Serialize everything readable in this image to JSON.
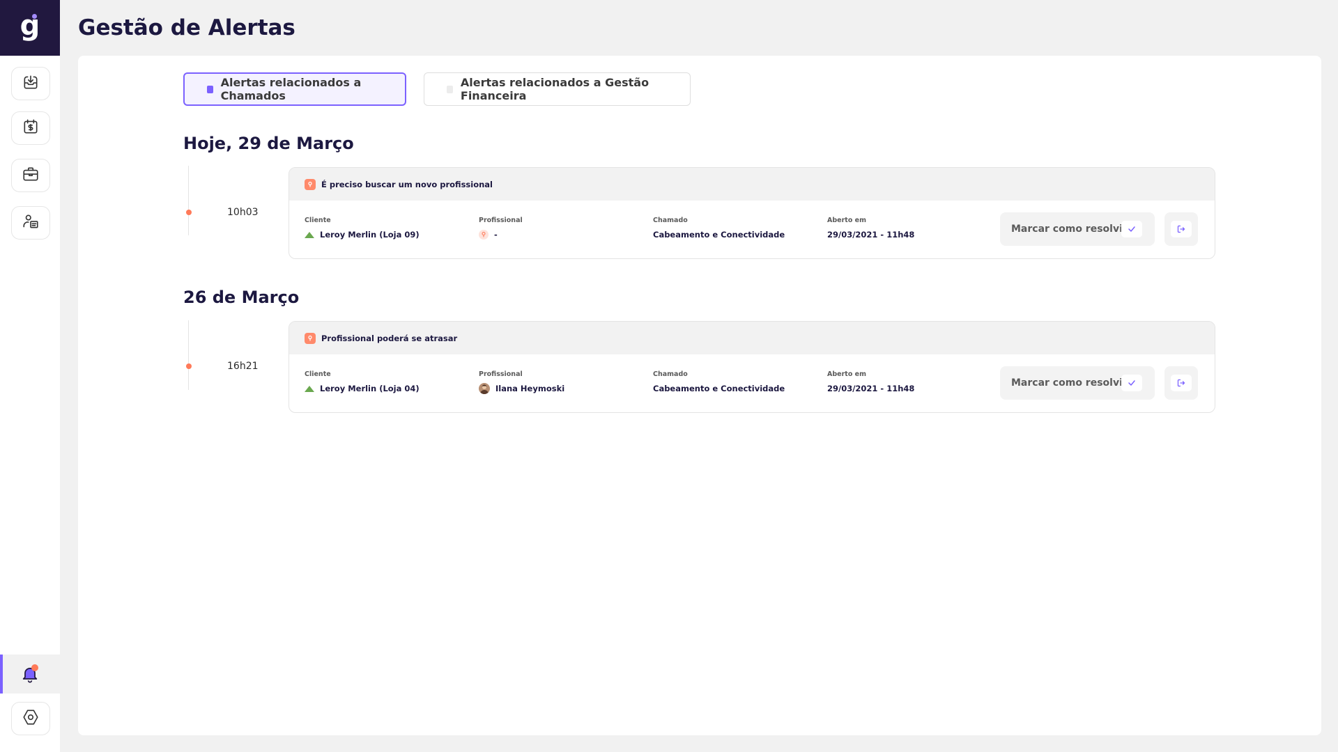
{
  "page": {
    "title": "Gestão de Alertas"
  },
  "sidebar": {
    "logo_letter": "g",
    "items": [
      {
        "icon": "download-tray-icon"
      },
      {
        "icon": "finance-calendar-icon"
      },
      {
        "icon": "briefcase-icon"
      },
      {
        "icon": "user-document-icon"
      }
    ],
    "bottom": [
      {
        "icon": "bell-icon",
        "active": true,
        "has_notification": true
      },
      {
        "icon": "settings-hexagon-icon"
      }
    ]
  },
  "tabs": [
    {
      "label": "Alertas relacionados a Chamados",
      "active": true
    },
    {
      "label": "Alertas relacionados a Gestão Financeira",
      "active": false
    }
  ],
  "groups": [
    {
      "date": "Hoje, 29 de Março",
      "alerts": [
        {
          "time": "10h03",
          "title": "É preciso buscar um novo profissional",
          "client_label": "Cliente",
          "client": "Leroy Merlin (Loja 09)",
          "professional_label": "Profissional",
          "professional": "-",
          "ticket_label": "Chamado",
          "ticket": "Cabeamento e Conectividade",
          "opened_label": "Aberto em",
          "opened": "29/03/2021 - 11h48",
          "resolve_label": "Marcar como resolvido"
        }
      ]
    },
    {
      "date": "26 de Março",
      "alerts": [
        {
          "time": "16h21",
          "title": "Profissional poderá se atrasar",
          "client_label": "Cliente",
          "client": "Leroy Merlin (Loja 04)",
          "professional_label": "Profissional",
          "professional": "Ilana Heymoski",
          "ticket_label": "Chamado",
          "ticket": "Cabeamento e Conectividade",
          "opened_label": "Aberto em",
          "opened": "29/03/2021 - 11h48",
          "resolve_label": "Marcar como resolvido"
        }
      ]
    }
  ],
  "colors": {
    "brand_dark": "#21183f",
    "accent": "#7b61ff",
    "alert": "#ff7a59",
    "client_green": "#6aa84f"
  }
}
